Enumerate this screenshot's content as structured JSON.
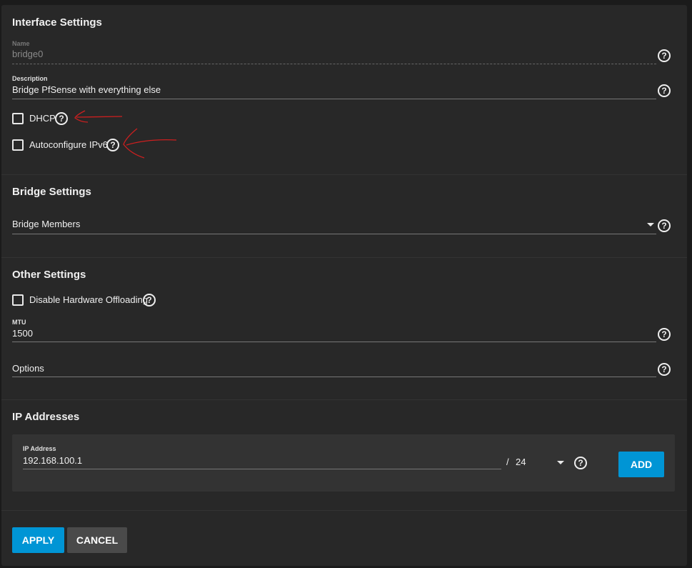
{
  "interface_settings": {
    "title": "Interface Settings",
    "name": {
      "label": "Name",
      "value": "bridge0"
    },
    "description": {
      "label": "Description",
      "value": "Bridge PfSense with everything else"
    },
    "dhcp": {
      "label": "DHCP",
      "checked": false
    },
    "autoconfigure_ipv6": {
      "label": "Autoconfigure IPv6",
      "checked": false
    }
  },
  "bridge_settings": {
    "title": "Bridge Settings",
    "bridge_members": {
      "label": "Bridge Members",
      "value": ""
    }
  },
  "other_settings": {
    "title": "Other Settings",
    "disable_hw_offloading": {
      "label": "Disable Hardware Offloading",
      "checked": false
    },
    "mtu": {
      "label": "MTU",
      "value": "1500"
    },
    "options": {
      "label": "Options",
      "value": ""
    }
  },
  "ip_addresses": {
    "title": "IP Addresses",
    "address": {
      "label": "IP Address",
      "value": "192.168.100.1",
      "separator": "/",
      "netmask": "24"
    },
    "add_label": "ADD"
  },
  "actions": {
    "apply_label": "APPLY",
    "cancel_label": "CANCEL"
  },
  "icons": {
    "help": "help-circle-icon",
    "caret": "dropdown-caret-icon",
    "arrow": "hand-drawn-arrow-annotation"
  },
  "colors": {
    "accent": "#0095d5",
    "background": "#282828",
    "annotation": "#cc1f1f"
  }
}
